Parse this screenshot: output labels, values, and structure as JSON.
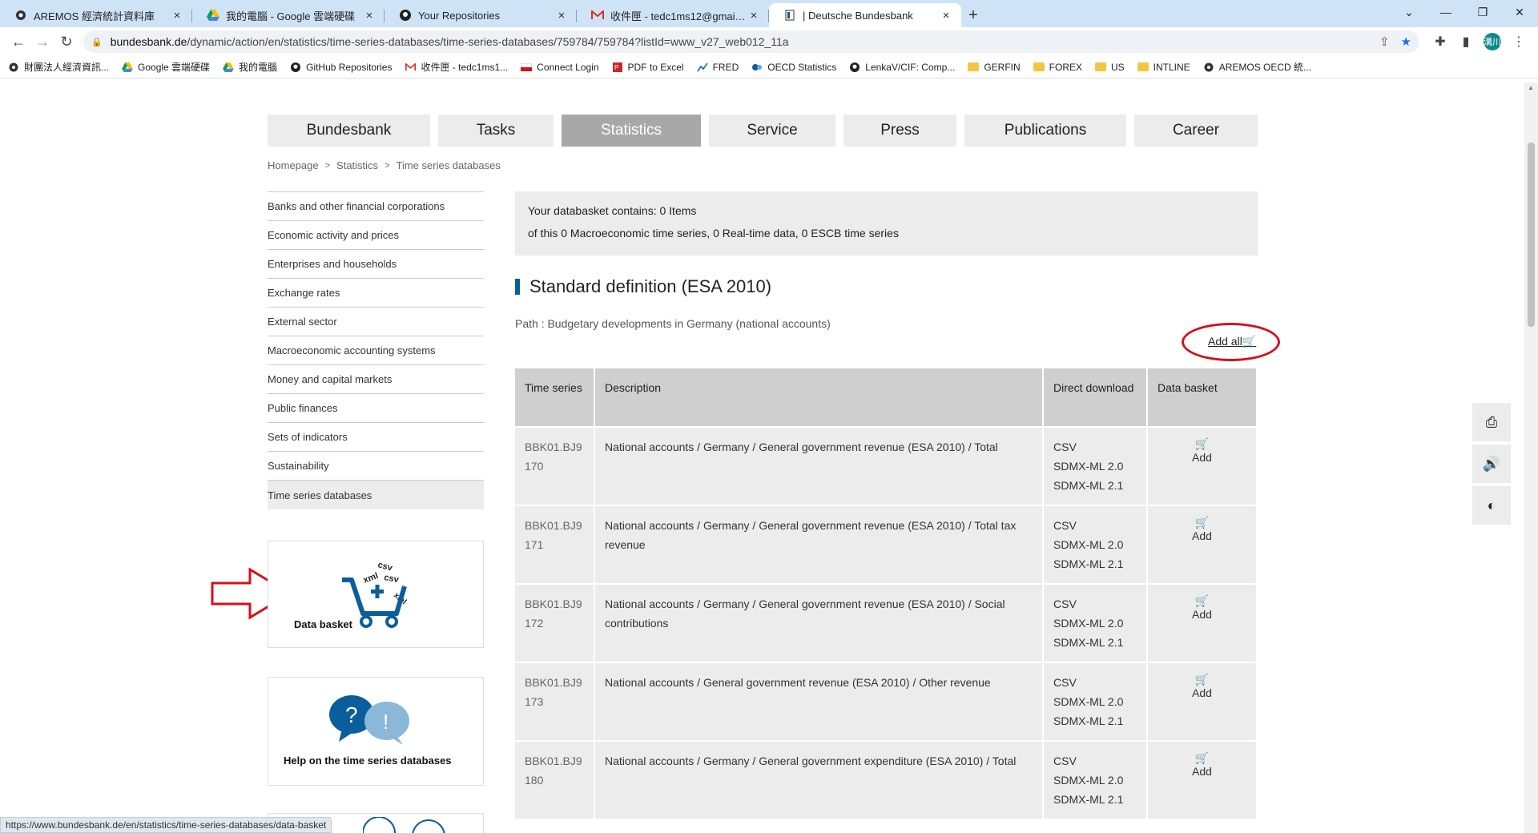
{
  "browser": {
    "tabs": [
      {
        "label": "AREMOS 經濟統計資料庫",
        "icon": "aremos-icon"
      },
      {
        "label": "我的電腦 - Google 雲端硬碟",
        "icon": "drive-icon"
      },
      {
        "label": "Your Repositories",
        "icon": "github-icon"
      },
      {
        "label": "收件匣 - tedc1ms12@gmail.com",
        "icon": "gmail-icon"
      },
      {
        "label": "| Deutsche Bundesbank",
        "icon": "bundesbank-icon"
      }
    ],
    "url_domain": "bundesbank.de",
    "url_path": "/dynamic/action/en/statistics/time-series-databases/time-series-databases/759784/759784?listId=www_v27_web012_11a",
    "profile_initials": "溝川",
    "bookmarks": [
      {
        "label": "財團法人經濟資訊...",
        "icon": "aremos-icon"
      },
      {
        "label": "Google 雲端硬碟",
        "icon": "drive-icon"
      },
      {
        "label": "我的電腦",
        "icon": "drive-icon"
      },
      {
        "label": "GitHub Repositories",
        "icon": "github-icon"
      },
      {
        "label": "收件匣 - tedc1ms1...",
        "icon": "gmail-icon"
      },
      {
        "label": "Connect Login",
        "icon": "flag-icon"
      },
      {
        "label": "PDF to Excel",
        "icon": "pdf-icon"
      },
      {
        "label": "FRED",
        "icon": "chart-icon"
      },
      {
        "label": "OECD Statistics",
        "icon": "oecd-icon"
      },
      {
        "label": "LenkaV/CIF: Comp...",
        "icon": "github-icon"
      },
      {
        "label": "GERFIN",
        "icon": "folder-icon"
      },
      {
        "label": "FOREX",
        "icon": "folder-icon"
      },
      {
        "label": "US",
        "icon": "folder-icon"
      },
      {
        "label": "INTLINE",
        "icon": "folder-icon"
      },
      {
        "label": "AREMOS OECD 統...",
        "icon": "aremos-icon"
      }
    ]
  },
  "mainnav": [
    "Bundesbank",
    "Tasks",
    "Statistics",
    "Service",
    "Press",
    "Publications",
    "Career"
  ],
  "breadcrumb": [
    "Homepage",
    "Statistics",
    "Time series databases"
  ],
  "sidenav": [
    "Banks and other financial corporations",
    "Economic activity and prices",
    "Enterprises and households",
    "Exchange rates",
    "External sector",
    "Macroeconomic accounting systems",
    "Money and capital markets",
    "Public finances",
    "Sets of indicators",
    "Sustainability",
    "Time series databases"
  ],
  "promos": {
    "basket_title": "Data basket",
    "basket_icon_text": [
      "csv",
      "xml",
      "csv",
      "xml"
    ],
    "help_title": "Help on the time series databases"
  },
  "basket": {
    "line1": "Your databasket contains: 0 Items",
    "line2": "of this 0 Macroeconomic time series, 0 Real-time data, 0 ESCB time series"
  },
  "section": {
    "title": "Standard definition (ESA 2010)",
    "path": "Path : Budgetary developments in Germany (national accounts)",
    "add_all": "Add all"
  },
  "table": {
    "headers": [
      "Time series",
      "Description",
      "Direct download",
      "Data basket"
    ],
    "rows": [
      {
        "ts": "BBK01.BJ9 170",
        "desc": "National accounts / Germany / General government revenue (ESA 2010) / Total",
        "dl": [
          "CSV",
          "SDMX-ML 2.0",
          "SDMX-ML 2.1"
        ],
        "add": "Add"
      },
      {
        "ts": "BBK01.BJ9 171",
        "desc": "National accounts / Germany / General government revenue (ESA 2010) / Total tax revenue",
        "dl": [
          "CSV",
          "SDMX-ML 2.0",
          "SDMX-ML 2.1"
        ],
        "add": "Add"
      },
      {
        "ts": "BBK01.BJ9 172",
        "desc": "National accounts / Germany / General government revenue (ESA 2010) / Social contributions",
        "dl": [
          "CSV",
          "SDMX-ML 2.0",
          "SDMX-ML 2.1"
        ],
        "add": "Add"
      },
      {
        "ts": "BBK01.BJ9 173",
        "desc": "National accounts / General government revenue (ESA 2010) / Other revenue",
        "dl": [
          "CSV",
          "SDMX-ML 2.0",
          "SDMX-ML 2.1"
        ],
        "add": "Add"
      },
      {
        "ts": "BBK01.BJ9 180",
        "desc": "National accounts / Germany / General government expenditure (ESA 2010) / Total",
        "dl": [
          "CSV",
          "SDMX-ML 2.0",
          "SDMX-ML 2.1"
        ],
        "add": "Add"
      }
    ]
  },
  "side_tools": [
    "printer-icon",
    "speaker-icon",
    "contrast-icon"
  ],
  "status_url": "https://www.bundesbank.de/en/statistics/time-series-databases/data-basket",
  "colors": {
    "accent": "#0b5e9c",
    "annotation": "#d4101a",
    "active_nav": "#a8a8a8"
  }
}
